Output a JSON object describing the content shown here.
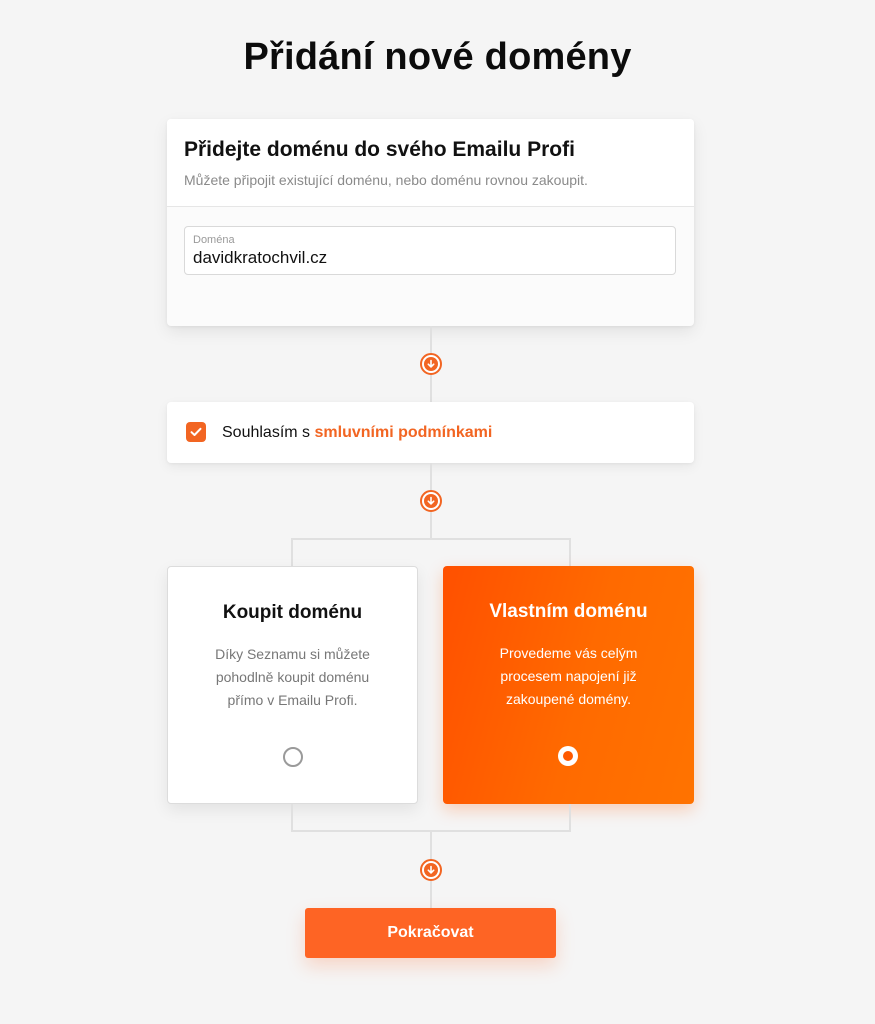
{
  "page": {
    "title": "Přidání nové domény"
  },
  "domain_card": {
    "heading": "Přidejte doménu do svého Emailu Profi",
    "subtitle": "Můžete připojit existující doménu, nebo doménu rovnou zakoupit.",
    "field_label": "Doména",
    "field_value": "davidkratochvil.cz"
  },
  "terms": {
    "checked": true,
    "text": "Souhlasím s",
    "link_label": "smluvními podmínkami"
  },
  "options": {
    "buy": {
      "title": "Koupit doménu",
      "description": "Díky Seznamu si můžete pohodlně koupit doménu přímo v Emailu Profi.",
      "selected": false
    },
    "own": {
      "title": "Vlastním doménu",
      "description": "Provedeme vás celým procesem napojení již zakoupené domény.",
      "selected": true
    }
  },
  "actions": {
    "continue_label": "Pokračovat"
  },
  "colors": {
    "accent": "#f26522",
    "button": "#fe6424",
    "option_selected_start": "#ff5000",
    "option_selected_end": "#ff7300"
  },
  "icons": {
    "step": "arrow-down-circle-icon",
    "checkbox": "checkmark-icon"
  }
}
